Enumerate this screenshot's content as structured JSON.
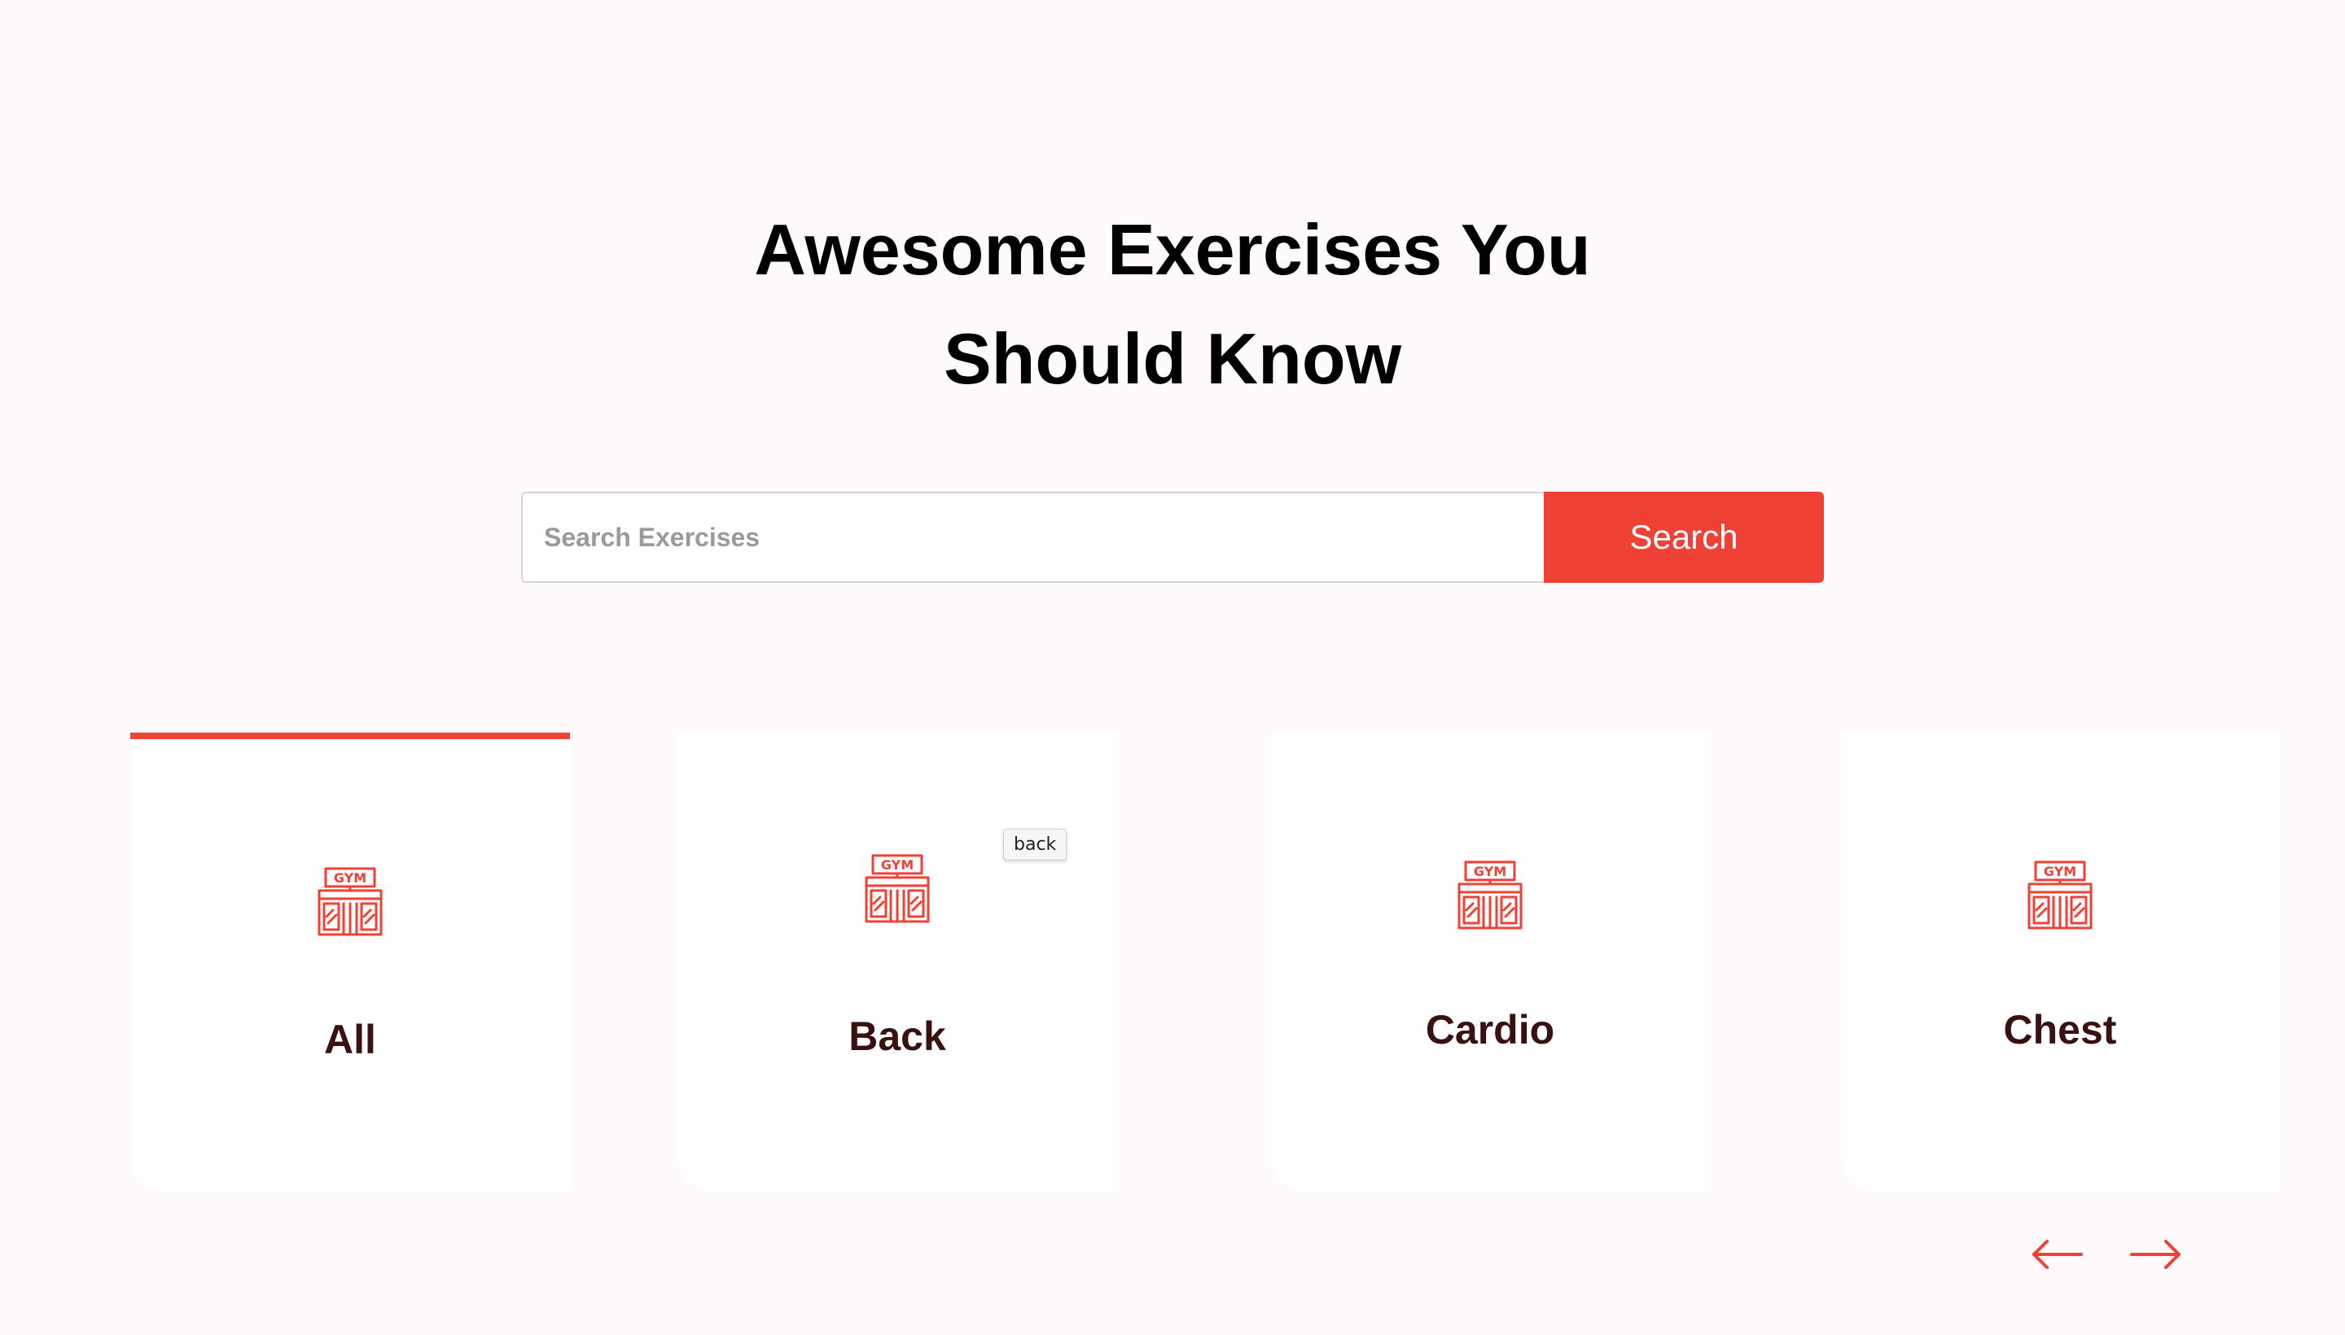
{
  "hero": {
    "title_line1": "Awesome Exercises You",
    "title_line2": "Should Know"
  },
  "search": {
    "placeholder": "Search Exercises",
    "value": "",
    "button_label": "Search"
  },
  "body_parts": [
    {
      "label": "All",
      "icon": "gym-icon",
      "selected": true
    },
    {
      "label": "Back",
      "icon": "gym-icon",
      "selected": false
    },
    {
      "label": "Cardio",
      "icon": "gym-icon",
      "selected": false
    },
    {
      "label": "Chest",
      "icon": "gym-icon",
      "selected": false
    }
  ],
  "tooltip": {
    "text": "back"
  },
  "pagination": {
    "prev_icon": "arrow-left-icon",
    "next_icon": "arrow-right-icon"
  },
  "colors": {
    "accent": "#ef4136",
    "background": "#fffafb",
    "label": "#3a1111"
  }
}
